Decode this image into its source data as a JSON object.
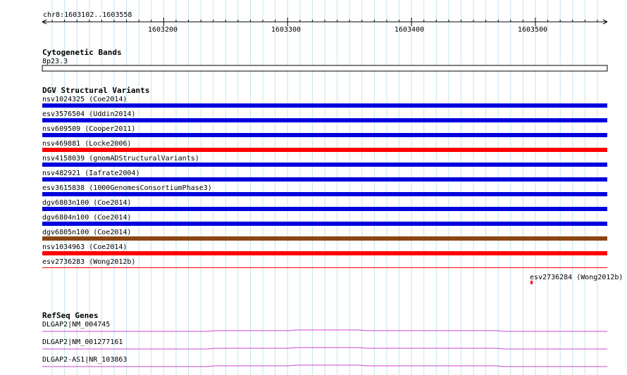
{
  "ruler": {
    "region": "chr8:1603102..1603558",
    "start": 1603102,
    "end": 1603558,
    "ticks": [
      "1603200",
      "1603300",
      "1603400",
      "1603500"
    ]
  },
  "cytobands": {
    "title": "Cytogenetic Bands",
    "band": "8p23.3"
  },
  "dgv": {
    "title": "DGV Structural Variants",
    "colors": {
      "blue": "#0000dd",
      "red": "#ff0000",
      "brown": "#8b4513"
    },
    "variants": [
      {
        "label": "nsv1024325 (Coe2014)",
        "color": "blue"
      },
      {
        "label": "esv3576504 (Uddin2014)",
        "color": "blue"
      },
      {
        "label": "nsv609509 (Cooper2011)",
        "color": "blue"
      },
      {
        "label": "nsv469881 (Locke2006)",
        "color": "red"
      },
      {
        "label": "nsv4158039 (gnomADStructuralVariants)",
        "color": "blue"
      },
      {
        "label": "nsv482921 (Iafrate2004)",
        "color": "blue"
      },
      {
        "label": "esv3615838 (1000GenomesConsortiumPhase3)",
        "color": "blue"
      },
      {
        "label": "dgv6803n100 (Coe2014)",
        "color": "blue"
      },
      {
        "label": "dgv6804n100 (Coe2014)",
        "color": "blue"
      },
      {
        "label": "dgv6805n100 (Coe2014)",
        "color": "brown"
      },
      {
        "label": "nsv1034963 (Coe2014)",
        "color": "red"
      },
      {
        "label": "esv2736283 (Wong2012b)",
        "color": "red"
      }
    ],
    "extra_feature": {
      "label": "esv2736284 (Wong2012b)",
      "color": "red"
    }
  },
  "refseq": {
    "title": "RefSeq Genes",
    "color": "#cc44cc",
    "genes": [
      {
        "label": "DLGAP2|NM_004745"
      },
      {
        "label": "DLGAP2|NM_001277161"
      },
      {
        "label": "DLGAP2-AS1|NR_103863"
      }
    ]
  }
}
